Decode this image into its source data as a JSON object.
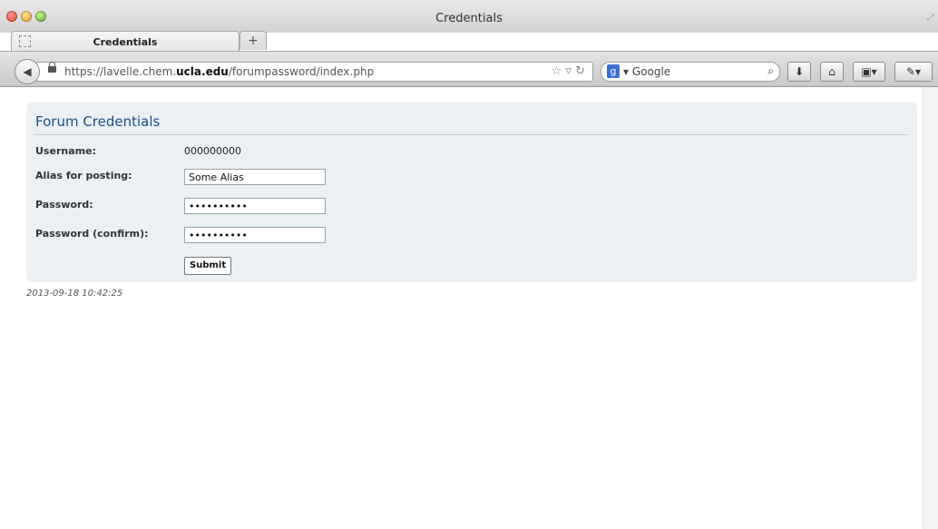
{
  "window": {
    "title": "Credentials"
  },
  "tabs": [
    {
      "label": "Credentials"
    }
  ],
  "toolbar": {
    "url_prefix": "https://lavelle.chem.",
    "url_domain": "ucla.edu",
    "url_path": "/forumpassword/index.php",
    "search_engine": "Google"
  },
  "form": {
    "title": "Forum Credentials",
    "username_label": "Username:",
    "username_value": "000000000",
    "alias_label": "Alias for posting:",
    "alias_value": "Some Alias",
    "password_label": "Password:",
    "password_value": "••••••••••",
    "confirm_label": "Password (confirm):",
    "confirm_value": "••••••••••",
    "submit_label": "Submit"
  },
  "footer": {
    "timestamp": "2013-09-18 10:42:25"
  }
}
